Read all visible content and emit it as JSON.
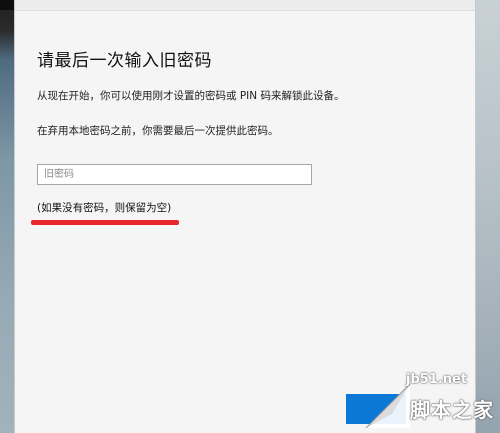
{
  "dialog": {
    "title": "请最后一次输入旧密码",
    "description_1": "从现在开始，你可以使用刚才设置的密码或 PIN 码来解锁此设备。",
    "description_2": "在弃用本地密码之前，你需要最后一次提供此密码。",
    "password_field": {
      "placeholder": "旧密码",
      "value": ""
    },
    "hint": "(如果没有密码，则保留为空)",
    "annotation_color": "#e8262c",
    "accent_color": "#0a78d4"
  },
  "watermark": {
    "site": "jb51.net",
    "name": "脚本之家"
  }
}
